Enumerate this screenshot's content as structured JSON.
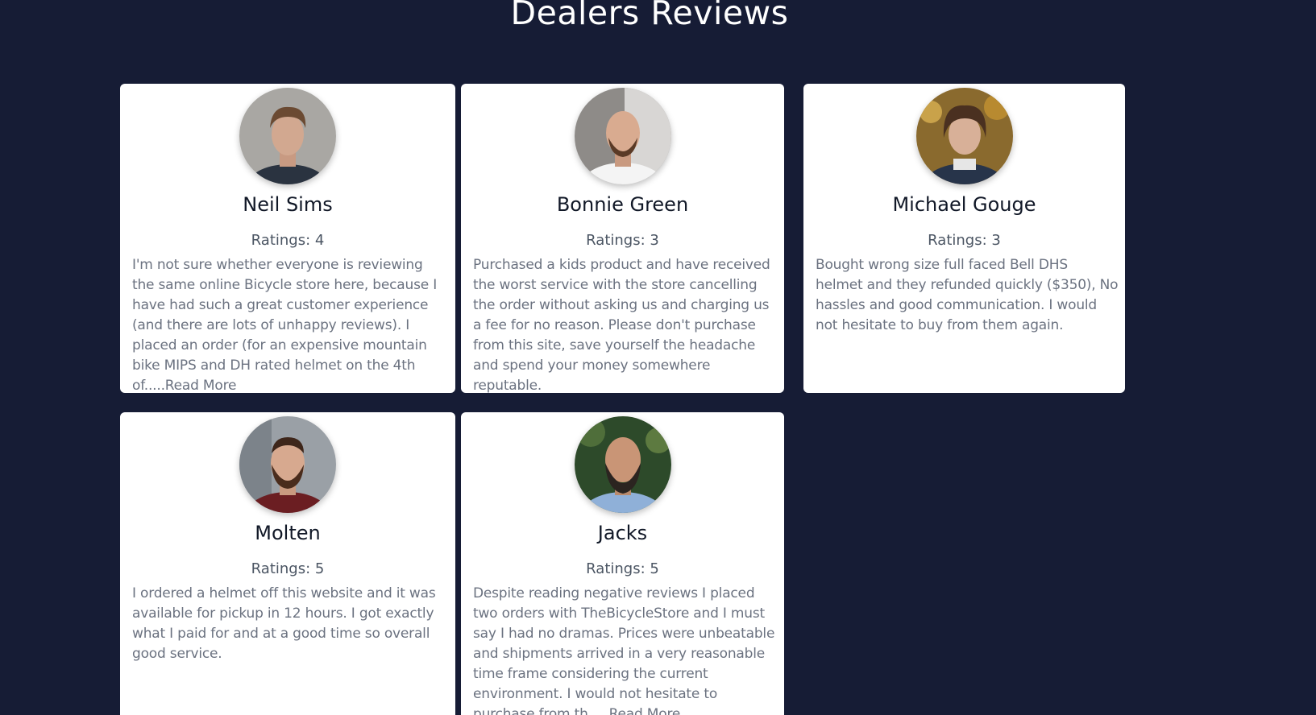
{
  "page": {
    "title": "Dealers Reviews"
  },
  "colors": {
    "background": "#161c35",
    "card": "#ffffff",
    "name_text": "#111827",
    "rating_text": "#4b5563",
    "review_text": "#6b7280"
  },
  "reviews": [
    {
      "avatar_icon": "profile-photo",
      "name": "Neil Sims",
      "rating_label": "Ratings: 4",
      "rating": 4,
      "text": "I'm not sure whether everyone is reviewing the same online Bicycle store here, because I have had such a great customer experience (and there are lots of unhappy reviews). I placed an order (for an expensive mountain bike MIPS and DH rated helmet on the 4th of.....",
      "read_more": "Read More"
    },
    {
      "avatar_icon": "profile-photo",
      "name": "Bonnie Green",
      "rating_label": "Ratings: 3",
      "rating": 3,
      "text": "Purchased a kids product and have received the worst service with the store cancelling the order without asking us and charging us a fee for no reason. Please don't purchase from this site, save yourself the headache and spend your money somewhere reputable.",
      "read_more": ""
    },
    {
      "avatar_icon": "profile-photo",
      "name": "Michael Gouge",
      "rating_label": "Ratings: 3",
      "rating": 3,
      "text": "Bought wrong size full faced Bell DHS helmet and they refunded quickly ($350), No hassles and good communication. I would not hesitate to buy from them again.",
      "read_more": ""
    },
    {
      "avatar_icon": "profile-photo",
      "name": "Molten",
      "rating_label": "Ratings: 5",
      "rating": 5,
      "text": "I ordered a helmet off this website and it was available for pickup in 12 hours. I got exactly what I paid for and at a good time so overall good service.",
      "read_more": ""
    },
    {
      "avatar_icon": "profile-photo",
      "name": "Jacks",
      "rating_label": "Ratings: 5",
      "rating": 5,
      "text": "Despite reading negative reviews I placed two orders with TheBicycleStore and I must say I had no dramas. Prices were unbeatable and shipments arrived in a very reasonable time frame considering the current environment. I would not hesitate to purchase from th.....",
      "read_more": "Read More"
    }
  ]
}
